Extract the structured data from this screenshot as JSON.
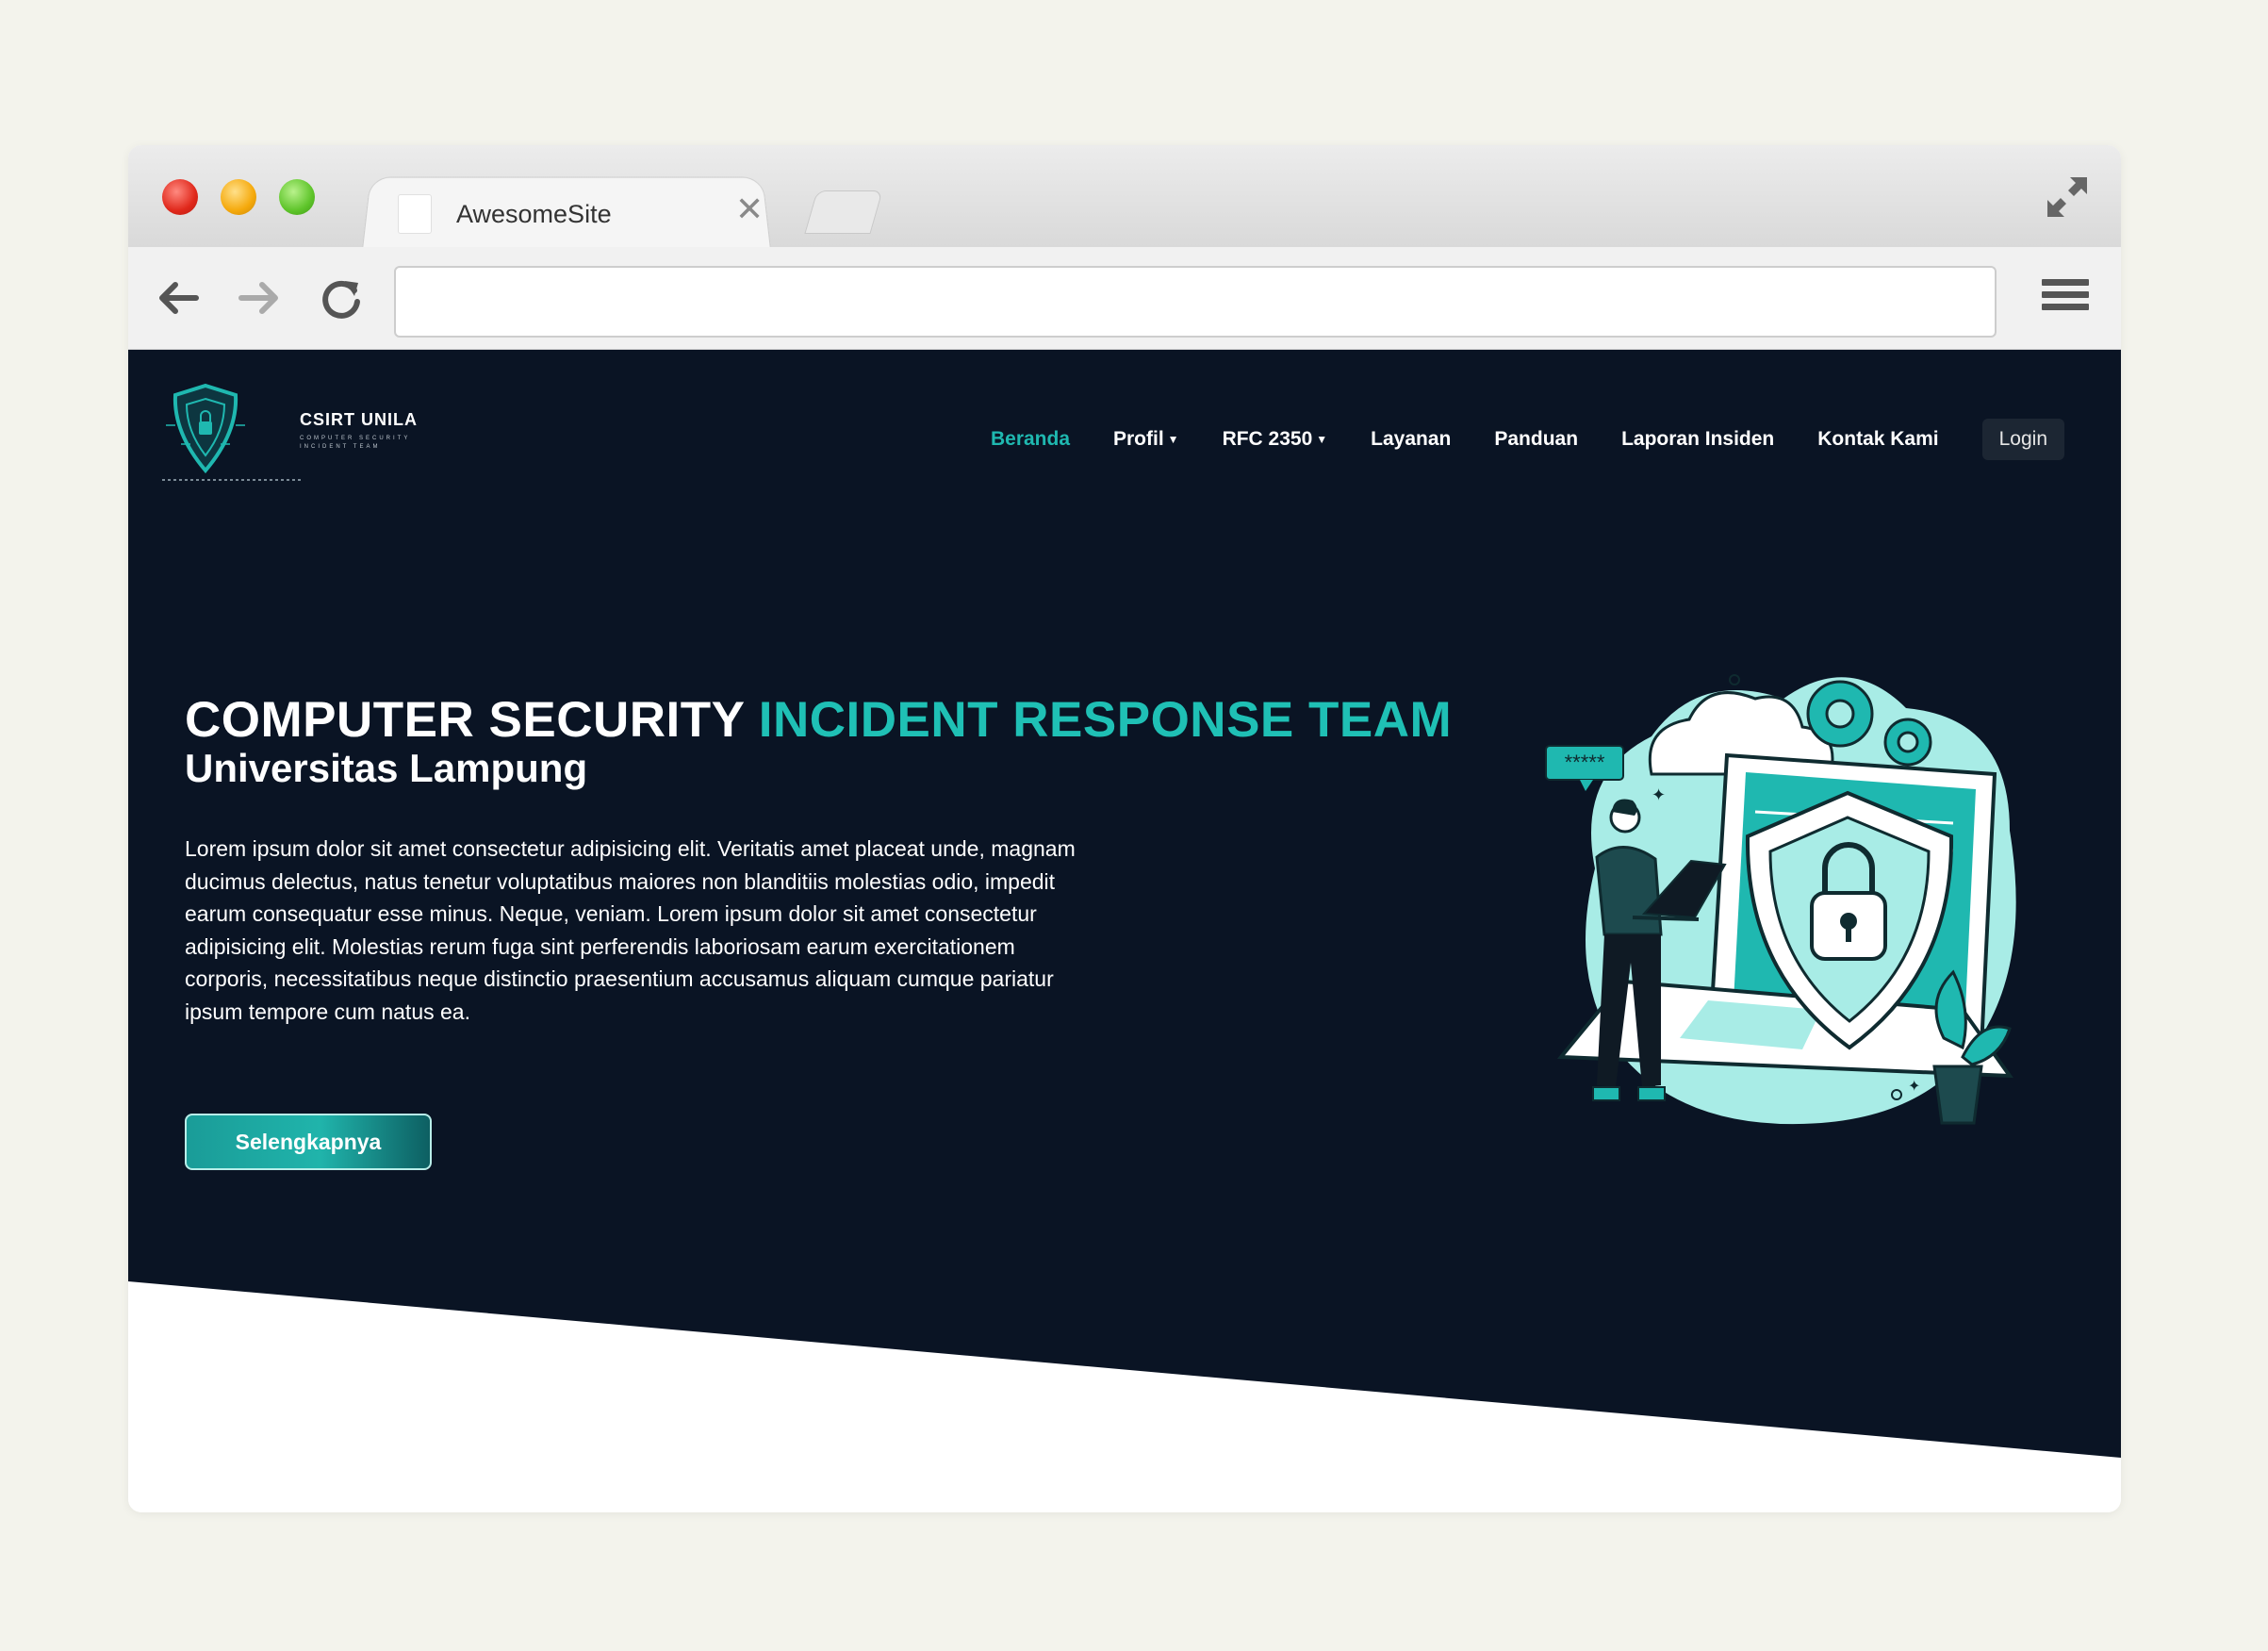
{
  "browser": {
    "tab_title": "AwesomeSite",
    "address_value": "",
    "icons": [
      "close-icon",
      "new-tab-icon",
      "fullscreen-icon",
      "back-arrow-icon",
      "forward-arrow-icon",
      "reload-icon",
      "hamburger-menu-icon"
    ]
  },
  "site": {
    "logo": {
      "title": "CSIRT UNILA",
      "subtitle": "COMPUTER SECURITY INCIDENT TEAM"
    },
    "nav": {
      "items": [
        {
          "label": "Beranda",
          "active": true,
          "dropdown": false
        },
        {
          "label": "Profil",
          "active": false,
          "dropdown": true
        },
        {
          "label": "RFC 2350",
          "active": false,
          "dropdown": true
        },
        {
          "label": "Layanan",
          "active": false,
          "dropdown": false
        },
        {
          "label": "Panduan",
          "active": false,
          "dropdown": false
        },
        {
          "label": "Laporan Insiden",
          "active": false,
          "dropdown": false
        },
        {
          "label": "Kontak Kami",
          "active": false,
          "dropdown": false
        }
      ],
      "login": "Login"
    },
    "hero": {
      "title_main": "COMPUTER SECURITY ",
      "title_accent": "INCIDENT RESPONSE TEAM",
      "subtitle": "Universitas Lampung",
      "paragraph": "Lorem ipsum dolor sit amet consectetur adipisicing elit. Veritatis amet placeat unde, magnam ducimus delectus, natus tenetur voluptatibus maiores non blanditiis molestias odio, impedit earum consequatur esse minus. Neque, veniam. Lorem ipsum dolor sit amet consectetur adipisicing elit. Molestias rerum fuga sint perferendis laboriosam earum exercitationem corporis, necessitatibus neque distinctio praesentium accusamus aliquam cumque pariatur ipsum tempore cum natus ea.",
      "cta": "Selengkapnya",
      "illustration_badge": "*****"
    }
  },
  "colors": {
    "page_bg": "#f3f3ec",
    "hero_bg": "#0a1424",
    "accent": "#1fc0b5",
    "illustration_light": "#a8ece6"
  }
}
